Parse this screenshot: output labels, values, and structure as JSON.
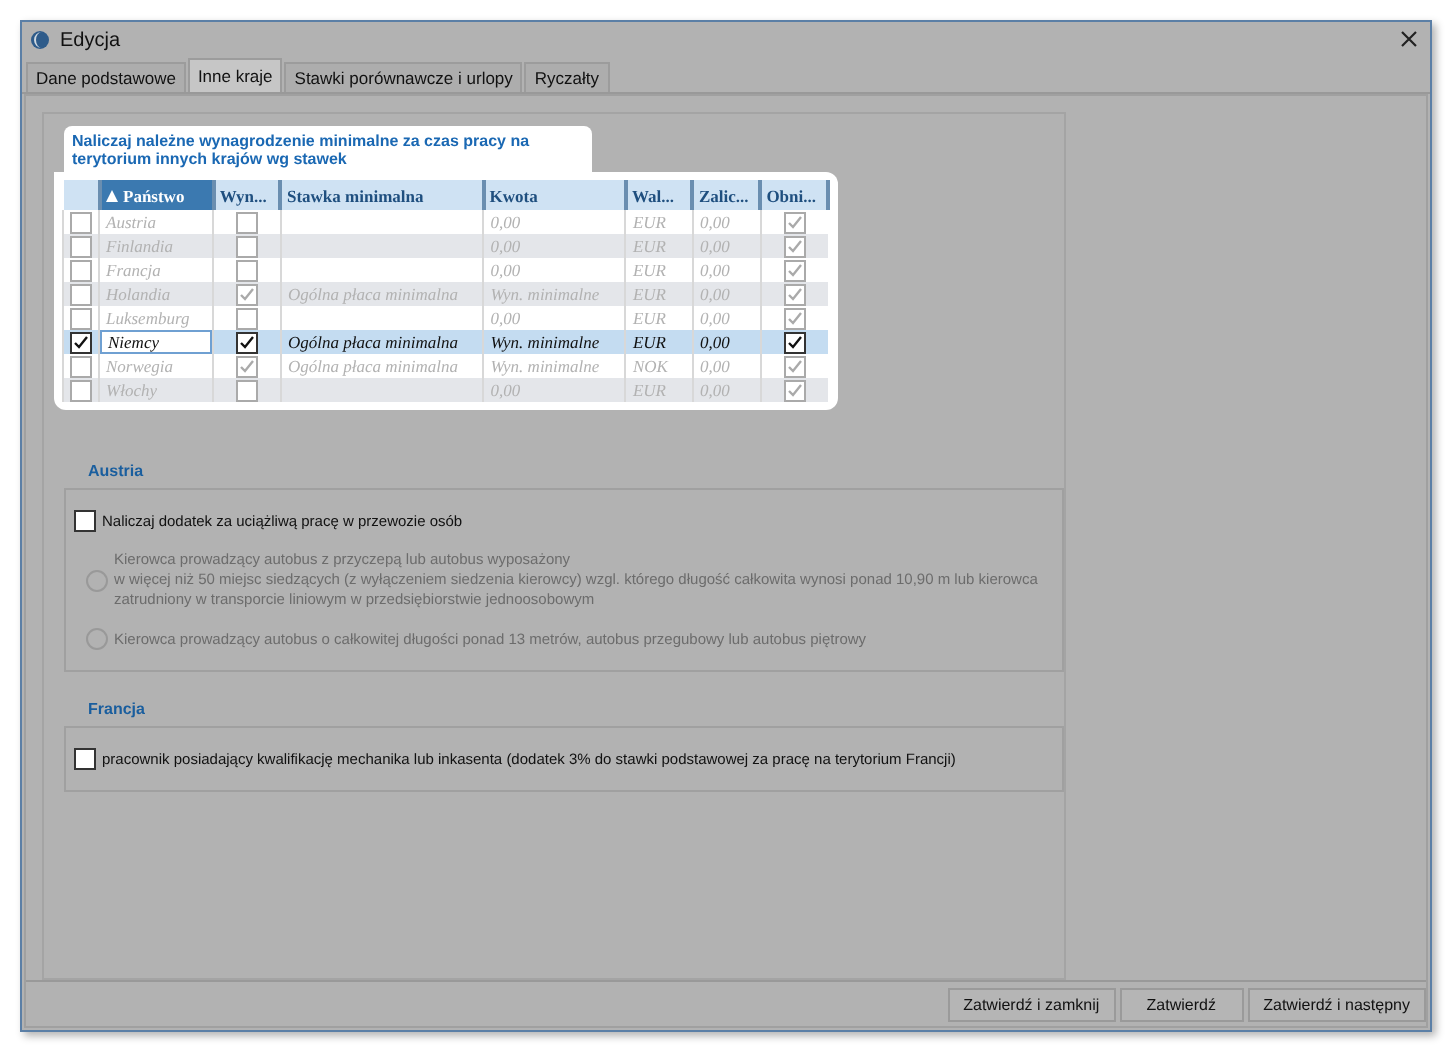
{
  "window": {
    "title": "Edycja"
  },
  "tabs": [
    {
      "label": "Dane podstawowe",
      "selected": false
    },
    {
      "label": "Inne kraje",
      "selected": true
    },
    {
      "label": "Stawki porównawcze i urlopy",
      "selected": false
    },
    {
      "label": "Ryczałty",
      "selected": false
    }
  ],
  "rates": {
    "heading": "Naliczaj należne wynagrodzenie minimalne za czas pracy na terytorium innych krajów wg stawek",
    "columns": [
      {
        "label": "Państwo",
        "sorted": true
      },
      {
        "label": "Wyn...",
        "sorted": false
      },
      {
        "label": "Stawka minimalna",
        "sorted": false
      },
      {
        "label": "Kwota",
        "sorted": false
      },
      {
        "label": "Wal...",
        "sorted": false
      },
      {
        "label": "Zalic...",
        "sorted": false
      },
      {
        "label": "Obni...",
        "sorted": false
      }
    ],
    "rows": [
      {
        "included": false,
        "selected": false,
        "country": "Austria",
        "wyn": false,
        "rate": null,
        "amount": "0,00",
        "currency": "EUR",
        "advance": "0,00",
        "obni": true
      },
      {
        "included": false,
        "selected": false,
        "country": "Finlandia",
        "wyn": false,
        "rate": null,
        "amount": "0,00",
        "currency": "EUR",
        "advance": "0,00",
        "obni": true
      },
      {
        "included": false,
        "selected": false,
        "country": "Francja",
        "wyn": false,
        "rate": null,
        "amount": "0,00",
        "currency": "EUR",
        "advance": "0,00",
        "obni": true
      },
      {
        "included": false,
        "selected": false,
        "country": "Holandia",
        "wyn": true,
        "rate": "Ogólna płaca minimalna",
        "amount": "Wyn. minimalne",
        "currency": "EUR",
        "advance": "0,00",
        "obni": true
      },
      {
        "included": false,
        "selected": false,
        "country": "Luksemburg",
        "wyn": false,
        "rate": null,
        "amount": "0,00",
        "currency": "EUR",
        "advance": "0,00",
        "obni": true
      },
      {
        "included": true,
        "selected": true,
        "country": "Niemcy",
        "wyn": true,
        "rate": "Ogólna płaca minimalna",
        "amount": "Wyn. minimalne",
        "currency": "EUR",
        "advance": "0,00",
        "obni": true
      },
      {
        "included": false,
        "selected": false,
        "country": "Norwegia",
        "wyn": true,
        "rate": "Ogólna płaca minimalna",
        "amount": "Wyn. minimalne",
        "currency": "NOK",
        "advance": "0,00",
        "obni": true
      },
      {
        "included": false,
        "selected": false,
        "country": "Włochy",
        "wyn": false,
        "rate": null,
        "amount": "0,00",
        "currency": "EUR",
        "advance": "0,00",
        "obni": true
      }
    ]
  },
  "sections": [
    {
      "title": "Austria",
      "options": [
        {
          "kind": "checkbox",
          "label": "Naliczaj dodatek za uciążliwą pracę w przewozie osób",
          "checked": false,
          "disabled": false
        },
        {
          "kind": "radio",
          "label": "Kierowca prowadzący autobus z przyczepą lub autobus wyposażony\nw więcej niż 50 miejsc siedzących (z wyłączeniem siedzenia kierowcy) wzgl. którego długość całkowita wynosi ponad 10,90 m lub kierowca\nzatrudniony w transporcie liniowym w przedsiębiorstwie jednoosobowym",
          "checked": false,
          "disabled": true
        },
        {
          "kind": "radio",
          "label": "Kierowca prowadzący autobus o całkowitej długości ponad 13 metrów, autobus przegubowy lub autobus piętrowy",
          "checked": false,
          "disabled": true
        }
      ]
    },
    {
      "title": "Francja",
      "options": [
        {
          "kind": "checkbox",
          "label": "pracownik posiadający kwalifikację mechanika lub inkasenta (dodatek 3% do stawki podstawowej za pracę na terytorium Francji)",
          "checked": false,
          "disabled": false
        }
      ]
    }
  ],
  "buttons": [
    "Zatwierdź i zamknij",
    "Zatwierdź",
    "Zatwierdź i następny"
  ]
}
